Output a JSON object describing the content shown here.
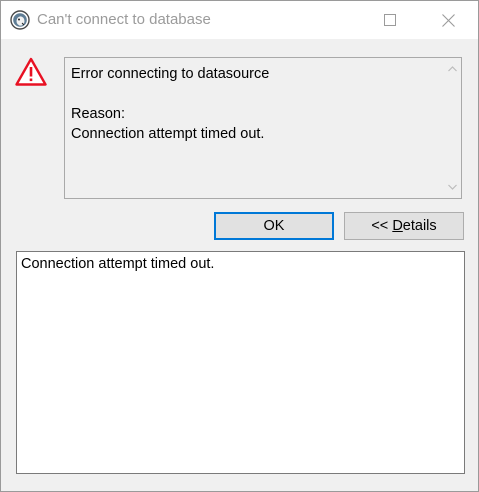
{
  "window": {
    "title": "Can't connect to database"
  },
  "message": {
    "text": "Error connecting to datasource\n\nReason:\nConnection attempt timed out."
  },
  "buttons": {
    "ok_label": "OK",
    "details_prefix": "<< ",
    "details_accel": "D",
    "details_rest": "etails"
  },
  "details": {
    "text": "Connection attempt timed out."
  },
  "icons": {
    "app": "dbeaver-beaver-icon",
    "warning": "warning-triangle-icon",
    "accent_color": "#0078d7",
    "warning_color": "#e81123"
  }
}
